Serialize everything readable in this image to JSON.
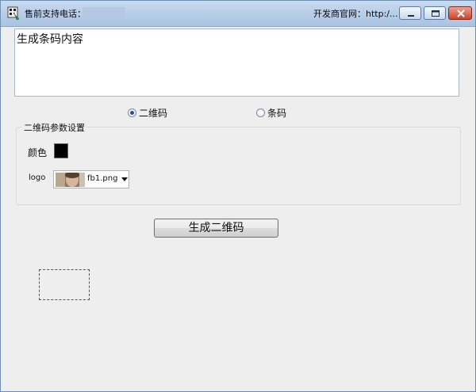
{
  "titlebar": {
    "presales_phone_label": "售前支持电话：",
    "developer_site": "开发商官网：http:/...",
    "icons": [
      "app-icon",
      "minimize-icon",
      "maximize-icon",
      "close-icon"
    ]
  },
  "content": {
    "value": "生成条码内容"
  },
  "mode": {
    "qr_label": "二维码",
    "barcode_label": "条码",
    "selected": "二维码"
  },
  "qr_settings": {
    "group_title": "二维码参数设置",
    "color_label": "颜色",
    "color_value": "#000000",
    "logo_label": "logo",
    "logo_file": "fb1.png"
  },
  "actions": {
    "generate_label": "生成二维码"
  }
}
